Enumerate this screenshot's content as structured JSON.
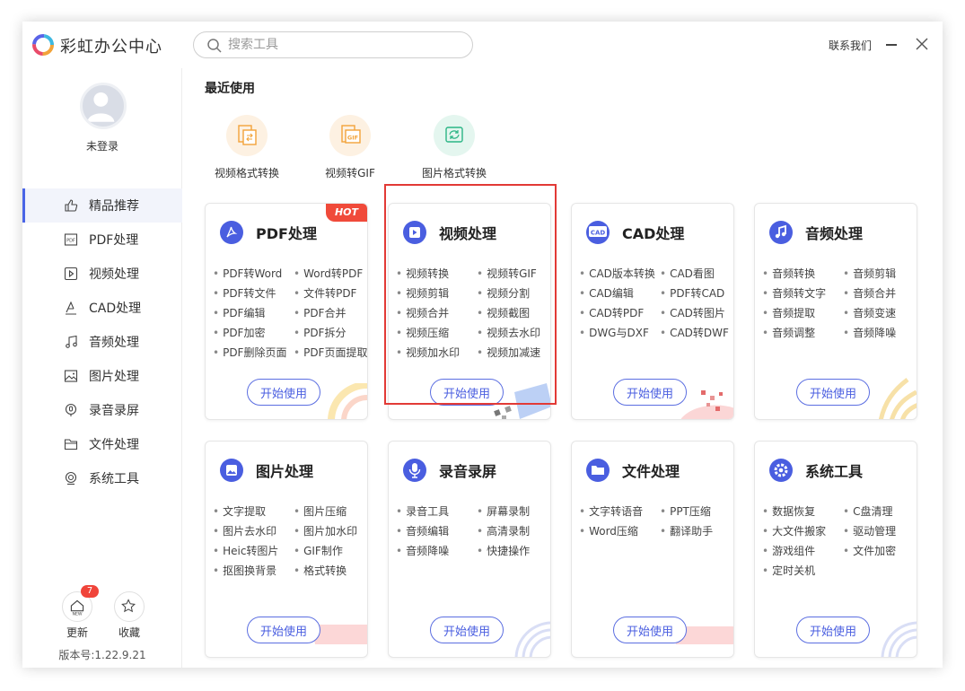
{
  "app": {
    "title": "彩虹办公中心"
  },
  "search": {
    "placeholder": "搜索工具"
  },
  "header": {
    "contact": "联系我们"
  },
  "sidebar": {
    "login": "未登录",
    "items": [
      {
        "label": "精品推荐",
        "icon": "thumbs-up-icon",
        "active": true
      },
      {
        "label": "PDF处理",
        "icon": "pdf-icon"
      },
      {
        "label": "视频处理",
        "icon": "video-icon"
      },
      {
        "label": "CAD处理",
        "icon": "cad-icon"
      },
      {
        "label": "音频处理",
        "icon": "music-icon"
      },
      {
        "label": "图片处理",
        "icon": "image-icon"
      },
      {
        "label": "录音录屏",
        "icon": "record-icon"
      },
      {
        "label": "文件处理",
        "icon": "folder-icon"
      },
      {
        "label": "系统工具",
        "icon": "system-icon"
      }
    ],
    "update": {
      "label": "更新",
      "badge": "7",
      "icon_text": "NEW"
    },
    "favorite": {
      "label": "收藏"
    },
    "version": "版本号:1.22.9.21"
  },
  "recent": {
    "title": "最近使用",
    "items": [
      {
        "label": "视频格式转换",
        "color": "#fdf1e2"
      },
      {
        "label": "视频转GIF",
        "color": "#fdf1e2"
      },
      {
        "label": "图片格式转换",
        "color": "#e4f6ef"
      }
    ]
  },
  "cards": [
    {
      "title": "PDF处理",
      "badge": "HOT",
      "features": [
        "PDF转Word",
        "Word转PDF",
        "PDF转文件",
        "文件转PDF",
        "PDF编辑",
        "PDF合并",
        "PDF加密",
        "PDF拆分",
        "PDF删除页面",
        "PDF页面提取"
      ],
      "button": "开始使用"
    },
    {
      "title": "视频处理",
      "features": [
        "视频转换",
        "视频转GIF",
        "视频剪辑",
        "视频分割",
        "视频合并",
        "视频截图",
        "视频压缩",
        "视频去水印",
        "视频加水印",
        "视频加减速"
      ],
      "button": "开始使用"
    },
    {
      "title": "CAD处理",
      "icon_text": "CAD",
      "features": [
        "CAD版本转换",
        "CAD看图",
        "CAD编辑",
        "PDF转CAD",
        "CAD转PDF",
        "CAD转图片",
        "DWG与DXF",
        "CAD转DWF"
      ],
      "button": "开始使用"
    },
    {
      "title": "音频处理",
      "features": [
        "音频转换",
        "音频剪辑",
        "音频转文字",
        "音频合并",
        "音频提取",
        "音频变速",
        "音频调整",
        "音频降噪"
      ],
      "button": "开始使用"
    },
    {
      "title": "图片处理",
      "features": [
        "文字提取",
        "图片压缩",
        "图片去水印",
        "图片加水印",
        "Heic转图片",
        "GIF制作",
        "抠图换背景",
        "格式转换"
      ],
      "button": "开始使用"
    },
    {
      "title": "录音录屏",
      "features": [
        "录音工具",
        "屏幕录制",
        "音频编辑",
        "高清录制",
        "音频降噪",
        "快捷操作"
      ],
      "button": "开始使用"
    },
    {
      "title": "文件处理",
      "features": [
        "文字转语音",
        "PPT压缩",
        "Word压缩",
        "翻译助手"
      ],
      "button": "开始使用"
    },
    {
      "title": "系统工具",
      "features": [
        "数据恢复",
        "C盘清理",
        "大文件搬家",
        "驱动管理",
        "游戏组件",
        "文件加密",
        "定时关机"
      ],
      "button": "开始使用"
    }
  ],
  "colors": {
    "accent": "#4a5ee0",
    "highlight": "#e23a36",
    "hot": "#f04a3a"
  }
}
